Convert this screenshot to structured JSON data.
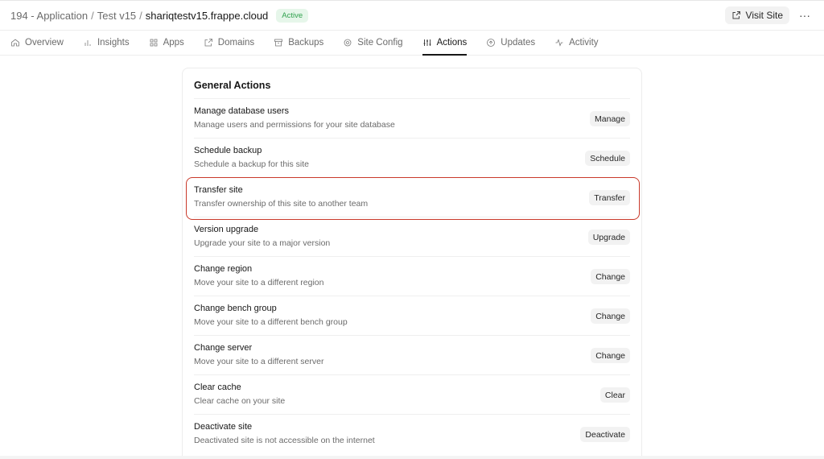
{
  "header": {
    "breadcrumb": [
      "194 - Application",
      "Test v15",
      "shariqtestv15.frappe.cloud"
    ],
    "separator": "/",
    "status": "Active",
    "visit_label": "Visit Site",
    "more": "···"
  },
  "tabs": [
    {
      "label": "Overview",
      "icon": "home-icon"
    },
    {
      "label": "Insights",
      "icon": "bar-chart-icon"
    },
    {
      "label": "Apps",
      "icon": "grid-icon"
    },
    {
      "label": "Domains",
      "icon": "external-link-icon"
    },
    {
      "label": "Backups",
      "icon": "archive-icon"
    },
    {
      "label": "Site Config",
      "icon": "gear-icon"
    },
    {
      "label": "Actions",
      "icon": "sliders-icon",
      "active": true
    },
    {
      "label": "Updates",
      "icon": "arrow-up-circle-icon"
    },
    {
      "label": "Activity",
      "icon": "activity-icon"
    }
  ],
  "actions": {
    "title": "General Actions",
    "rows": [
      {
        "title": "Manage database users",
        "desc": "Manage users and permissions for your site database",
        "button": "Manage"
      },
      {
        "title": "Schedule backup",
        "desc": "Schedule a backup for this site",
        "button": "Schedule"
      },
      {
        "title": "Transfer site",
        "desc": "Transfer ownership of this site to another team",
        "button": "Transfer",
        "highlighted": true
      },
      {
        "title": "Version upgrade",
        "desc": "Upgrade your site to a major version",
        "button": "Upgrade"
      },
      {
        "title": "Change region",
        "desc": "Move your site to a different region",
        "button": "Change"
      },
      {
        "title": "Change bench group",
        "desc": "Move your site to a different bench group",
        "button": "Change"
      },
      {
        "title": "Change server",
        "desc": "Move your site to a different server",
        "button": "Change"
      },
      {
        "title": "Clear cache",
        "desc": "Clear cache on your site",
        "button": "Clear"
      },
      {
        "title": "Deactivate site",
        "desc": "Deactivated site is not accessible on the internet",
        "button": "Deactivate"
      }
    ]
  },
  "colors": {
    "accent": "#171717",
    "active_badge_bg": "#e6f6ea",
    "active_badge_text": "#30a14e",
    "highlight": "#c9392a"
  }
}
